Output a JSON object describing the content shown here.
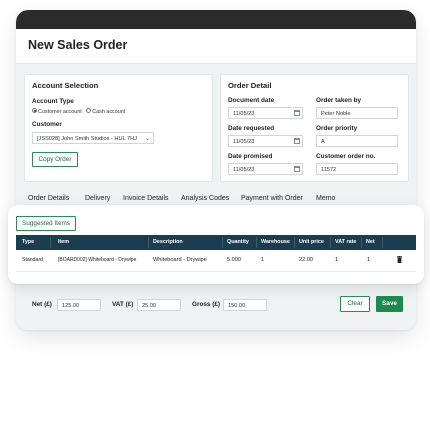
{
  "page_title": "New Sales Order",
  "account_selection": {
    "title": "Account Selection",
    "account_type_label": "Account Type",
    "options": [
      "Customer account",
      "Cash account"
    ],
    "customer_label": "Customer",
    "customer_value": "[JSS028] John Smith Studios - HUL 7HJ",
    "copy_order_label": "Copy Order"
  },
  "order_detail": {
    "title": "Order Detail",
    "document_date_label": "Document date",
    "document_date": "11/05/23",
    "date_requested_label": "Date requested",
    "date_requested": "11/05/23",
    "date_promised_label": "Date promised",
    "date_promised": "11/05/23",
    "order_taken_by_label": "Order taken by",
    "order_taken_by": "Peter Noble",
    "order_priority_label": "Order priority",
    "order_priority": "A",
    "customer_order_no_label": "Customer order no.",
    "customer_order_no": "11572"
  },
  "tabs": [
    "Order Details",
    "Delivery",
    "Invoice Details",
    "Analysis Codes",
    "Payment with Order",
    "Memo"
  ],
  "suggested_items_label": "Suggested Items",
  "table": {
    "headers": [
      "Type",
      "Item",
      "Description",
      "Quantity",
      "Warehouse",
      "Unit price",
      "VAT rate",
      "Net"
    ],
    "rows": [
      [
        "Standard",
        "[BOARD002] Whiteboard - Drywipe",
        "Whiteboard - Drywipe",
        "5.000",
        "1",
        "22.00",
        "1",
        "1"
      ]
    ]
  },
  "totals": {
    "net_label": "Net (£)",
    "net": "125.00",
    "vat_label": "VAT (£)",
    "vat": "25.00",
    "gross_label": "Gross (£)",
    "gross": "150.00",
    "clear_label": "Clear",
    "save_label": "Save"
  },
  "colors": {
    "accent": "#1f8a50",
    "header": "#1c3d4f",
    "topbar": "#2b2b2b"
  }
}
